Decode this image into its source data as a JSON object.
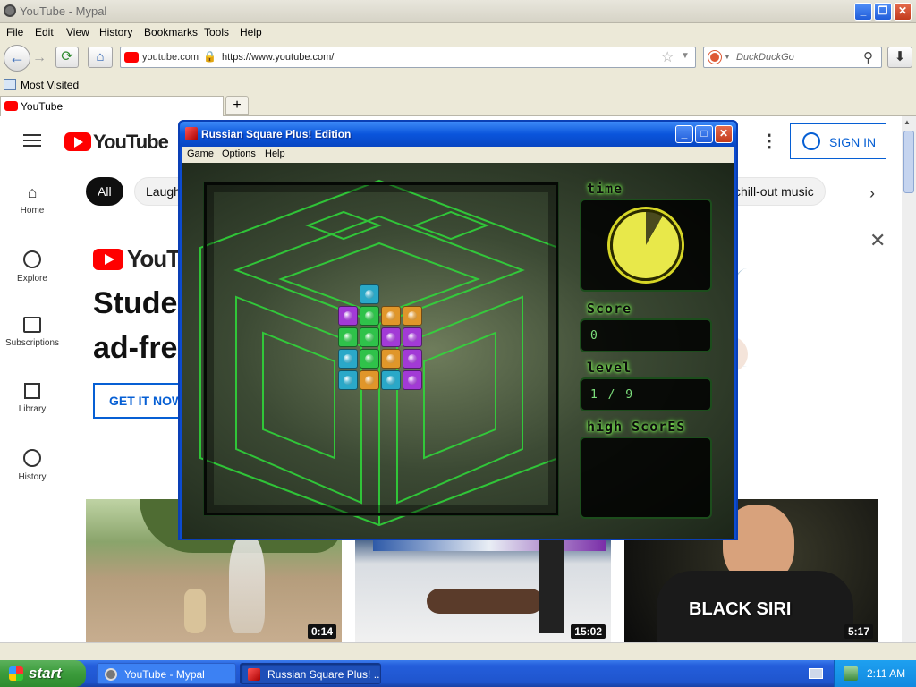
{
  "browser": {
    "title": "YouTube - Mypal",
    "menu": [
      "File",
      "Edit",
      "View",
      "History",
      "Bookmarks",
      "Tools",
      "Help"
    ],
    "site_identity": "youtube.com",
    "url": "https://www.youtube.com/",
    "search_placeholder": "DuckDuckGo",
    "bookmark_most_visited": "Most Visited",
    "tab_label": "YouTube",
    "new_tab": "+"
  },
  "youtube": {
    "logo_text": "YouTube",
    "sign_in": "SIGN IN",
    "sidebar": [
      {
        "label": "Home",
        "icon": "home-icon"
      },
      {
        "label": "Explore",
        "icon": "compass-icon"
      },
      {
        "label": "Subscriptions",
        "icon": "subscriptions-icon"
      },
      {
        "label": "Library",
        "icon": "library-icon"
      },
      {
        "label": "History",
        "icon": "history-icon"
      }
    ],
    "chips": [
      "All",
      "Laugh",
      "chill-out music"
    ],
    "banner": {
      "logo_text": "YouTub",
      "headline_1": "Studer",
      "headline_2": "ad-fre",
      "cta": "GET IT NOW"
    },
    "videos": [
      {
        "duration": "0:14",
        "overlay": ""
      },
      {
        "duration": "15:02",
        "overlay": ""
      },
      {
        "duration": "5:17",
        "overlay": "BLACK SIRI"
      }
    ]
  },
  "game": {
    "title": "Russian Square Plus! Edition",
    "menu": [
      "Game",
      "Options",
      "Help"
    ],
    "time_label": "time",
    "score_label": "Score",
    "score_value": "0",
    "level_label": "level",
    "level_value": "1 / 9",
    "high_scores_label": "high ScorES",
    "colors": {
      "teal": "#2aa8c8",
      "purple": "#a23ad6",
      "green": "#2fc24a",
      "orange": "#e0962a"
    }
  },
  "taskbar": {
    "start": "start",
    "tasks": [
      "YouTube - Mypal",
      "Russian Square Plus! ..."
    ],
    "clock": "2:11 AM"
  }
}
